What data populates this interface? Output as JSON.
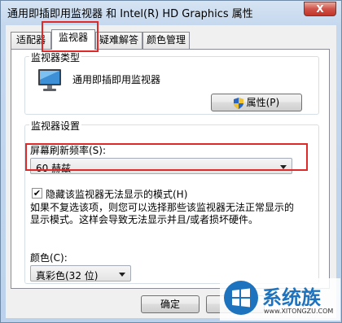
{
  "window": {
    "title": "通用即插即用监视器 和 Intel(R) HD Graphics 属性",
    "close_label": "X"
  },
  "tabs": [
    {
      "label": "适配器"
    },
    {
      "label": "监视器"
    },
    {
      "label": "疑难解答"
    },
    {
      "label": "颜色管理"
    }
  ],
  "monitor_type": {
    "group_title": "监视器类型",
    "name": "通用即插即用监视器",
    "properties_button": "属性(P)"
  },
  "monitor_settings": {
    "group_title": "监视器设置",
    "refresh_label": "屏幕刷新频率(S):",
    "refresh_value": "60 赫兹",
    "hide_modes_checked": true,
    "hide_modes_label": "隐藏该监视器无法显示的模式(H)",
    "hide_modes_desc_line1": "如果不复选该项，则您可以选择那些该监视器无法正常显示的",
    "hide_modes_desc_line2": "显示模式。这样会导致无法显示并且/或者损坏硬件。",
    "color_label": "颜色(C):",
    "color_value": "真彩色(32 位)"
  },
  "footer": {
    "ok_button": "确定",
    "cancel_button": "取"
  },
  "watermark": {
    "brand": "系统族",
    "url": "www.XITONGZU.COM"
  },
  "colors": {
    "highlight": "#e02a2a",
    "accent": "#1e73be"
  }
}
